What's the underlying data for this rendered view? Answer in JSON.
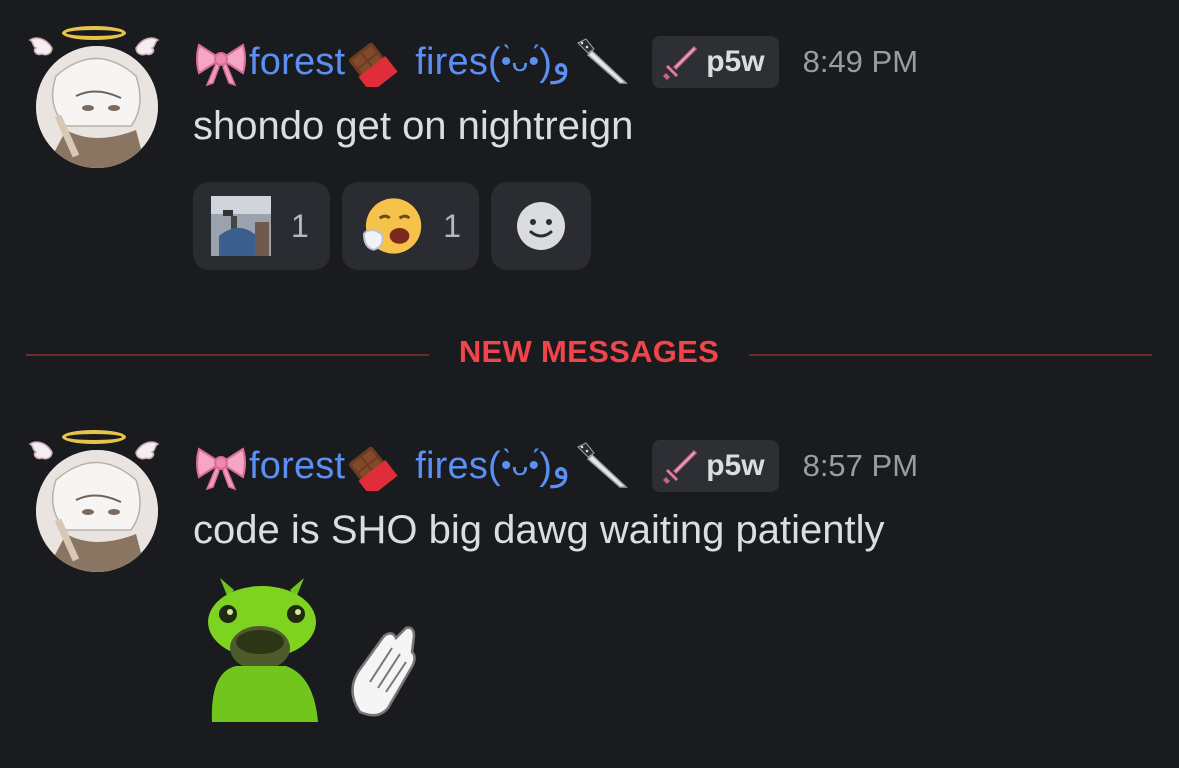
{
  "messages": [
    {
      "username_a": "forest",
      "username_b": "fires(",
      "username_face": "•̀ᴗ•́",
      "username_c": ")و",
      "username_tail": "̑̑",
      "role_tag": "p5w",
      "timestamp": "8:49 PM",
      "text": "shondo get on nightreign",
      "reactions": [
        {
          "kind": "custom-image",
          "count": "1"
        },
        {
          "kind": "tired-face-emoji",
          "count": "1"
        }
      ]
    },
    {
      "username_a": "forest",
      "username_b": "fires(",
      "username_face": "•̀ᴗ•́",
      "username_c": ")و",
      "username_tail": "̑̑",
      "role_tag": "p5w",
      "timestamp": "8:57 PM",
      "text": "code is SHO big dawg waiting patiently",
      "stickers": [
        "green-frog-sticker",
        "clapping-hands-icon"
      ]
    }
  ],
  "divider": {
    "label": "NEW MESSAGES"
  },
  "colors": {
    "background": "#1a1b1f",
    "username": "#5b8ff1",
    "new_messages": "#f0454a",
    "text": "#dbdee1",
    "timestamp": "#9a9ca3"
  }
}
